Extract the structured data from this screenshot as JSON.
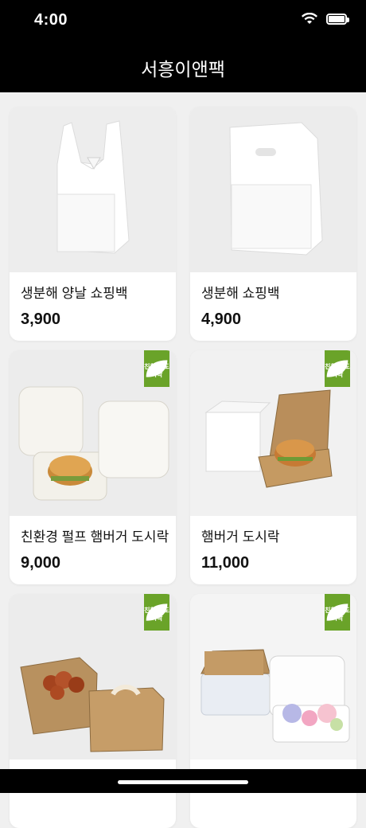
{
  "status": {
    "time": "4:00"
  },
  "header": {
    "title": "서흥이앤팩"
  },
  "products": [
    {
      "name": "생분해 양날 쇼핑백",
      "price": "3,900",
      "badge": ""
    },
    {
      "name": "생분해 쇼핑백",
      "price": "4,900",
      "badge": ""
    },
    {
      "name": "친환경 펄프 햄버거 도시락",
      "price": "9,000",
      "badge": "친환경 도시락"
    },
    {
      "name": "햄버거 도시락",
      "price": "11,000",
      "badge": "친환경 도시락"
    },
    {
      "name": "",
      "price": "",
      "badge": "친환경 도시락"
    },
    {
      "name": "",
      "price": "",
      "badge": "친환경 도시락"
    }
  ],
  "badge_color": "#6aa329"
}
